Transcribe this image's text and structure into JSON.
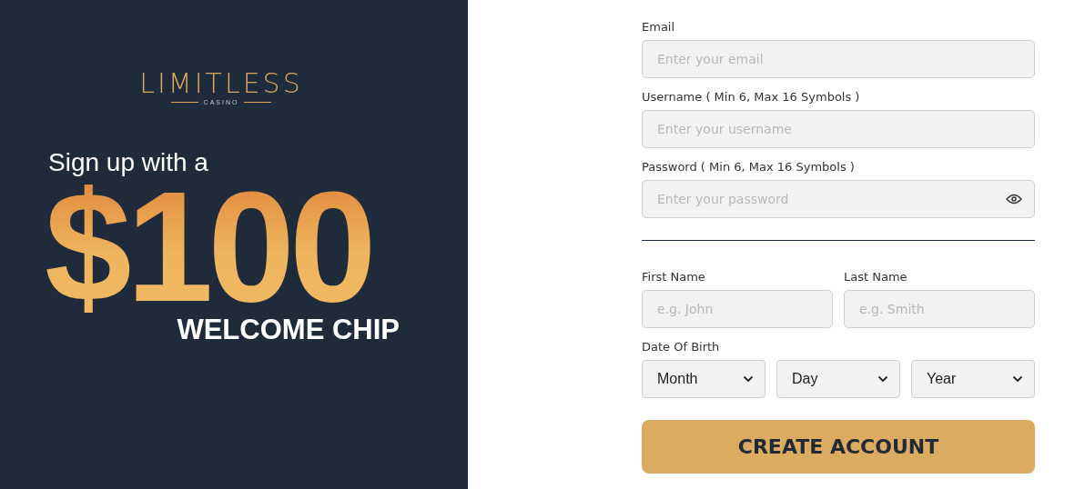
{
  "promo": {
    "logo": {
      "name": "LIMITLESS",
      "tagline": "CASINO"
    },
    "intro": "Sign up with a",
    "amount": "$100",
    "offer": "WELCOME CHIP"
  },
  "account_fields": [
    {
      "label": "Email",
      "placeholder": "Enter your email",
      "kind": "text"
    },
    {
      "label": "Username ( Min 6, Max 16 Symbols )",
      "placeholder": "Enter your username",
      "kind": "text"
    },
    {
      "label": "Password ( Min 6, Max 16 Symbols )",
      "placeholder": "Enter your password",
      "kind": "password"
    }
  ],
  "name_fields": [
    {
      "label": "First Name",
      "placeholder": "e.g. John"
    },
    {
      "label": "Last Name",
      "placeholder": "e.g. Smith"
    }
  ],
  "date_of_birth": {
    "label": "Date Of Birth",
    "selects": [
      "Month",
      "Day",
      "Year"
    ]
  },
  "submit": "CREATE ACCOUNT"
}
